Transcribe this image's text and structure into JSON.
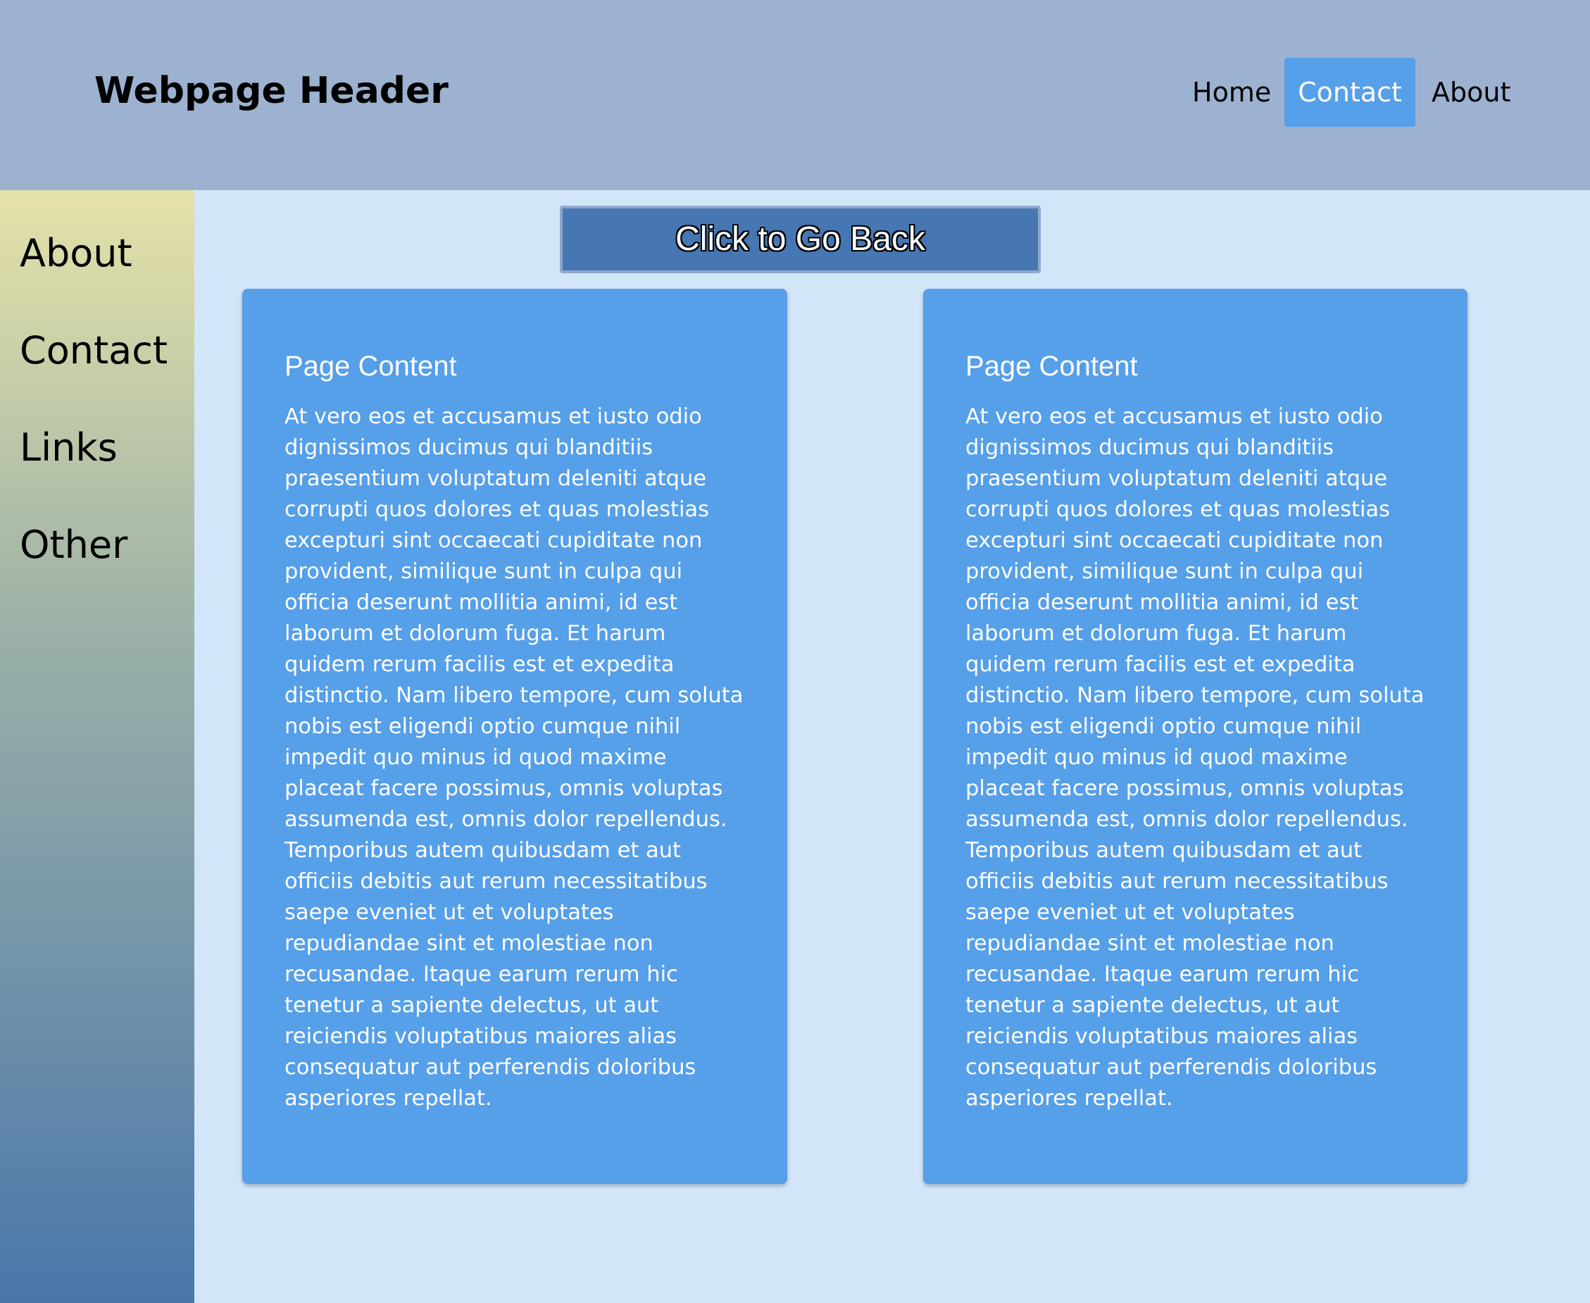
{
  "header": {
    "title": "Webpage Header",
    "nav": {
      "home": "Home",
      "contact": "Contact",
      "about": "About",
      "active": "Contact"
    }
  },
  "sidebar": {
    "items": [
      {
        "label": "About"
      },
      {
        "label": "Contact"
      },
      {
        "label": "Links"
      },
      {
        "label": "Other"
      }
    ]
  },
  "main": {
    "back_button_label": "Click to Go Back",
    "cards": [
      {
        "title": "Page Content",
        "body": "At vero eos et accusamus et iusto odio dignissimos ducimus qui blanditiis praesentium voluptatum deleniti atque corrupti quos dolores et quas molestias excepturi sint occaecati cupiditate non provident, similique sunt in culpa qui officia deserunt mollitia animi, id est laborum et dolorum fuga. Et harum quidem rerum facilis est et expedita distinctio. Nam libero tempore, cum soluta nobis est eligendi optio cumque nihil impedit quo minus id quod maxime placeat facere possimus, omnis voluptas assumenda est, omnis dolor repellendus. Temporibus autem quibusdam et aut officiis debitis aut rerum necessitatibus saepe eveniet ut et voluptates repudiandae sint et molestiae non recusandae. Itaque earum rerum hic tenetur a sapiente delectus, ut aut reiciendis voluptatibus maiores alias consequatur aut perferendis doloribus asperiores repellat."
      },
      {
        "title": "Page Content",
        "body": "At vero eos et accusamus et iusto odio dignissimos ducimus qui blanditiis praesentium voluptatum deleniti atque corrupti quos dolores et quas molestias excepturi sint occaecati cupiditate non provident, similique sunt in culpa qui officia deserunt mollitia animi, id est laborum et dolorum fuga. Et harum quidem rerum facilis est et expedita distinctio. Nam libero tempore, cum soluta nobis est eligendi optio cumque nihil impedit quo minus id quod maxime placeat facere possimus, omnis voluptas assumenda est, omnis dolor repellendus. Temporibus autem quibusdam et aut officiis debitis aut rerum necessitatibus saepe eveniet ut et voluptates repudiandae sint et molestiae non recusandae. Itaque earum rerum hic tenetur a sapiente delectus, ut aut reiciendis voluptatibus maiores alias consequatur aut perferendis doloribus asperiores repellat."
      }
    ]
  },
  "colors": {
    "header_bg": "#9db2d0",
    "page_bg": "#d3e6f9",
    "accent": "#569fe9",
    "button_bg": "#4677b2",
    "sidebar_gradient_top": "#e5e2a8",
    "sidebar_gradient_bottom": "#4a76aa"
  }
}
